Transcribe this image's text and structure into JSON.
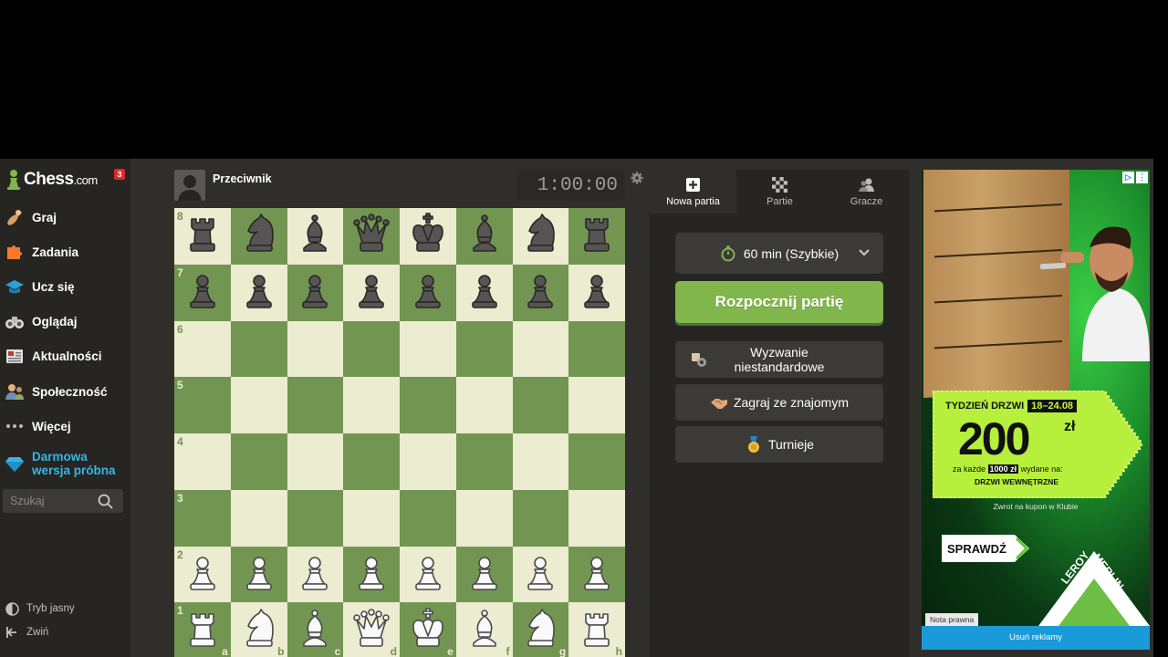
{
  "sidebar": {
    "logo": "Chess",
    "logo_suffix": ".com",
    "notification_count": "3",
    "nav": [
      {
        "label": "Graj",
        "icon": "pawn-hand-icon"
      },
      {
        "label": "Zadania",
        "icon": "puzzle-icon"
      },
      {
        "label": "Ucz się",
        "icon": "graduation-cap-icon"
      },
      {
        "label": "Oglądaj",
        "icon": "binoculars-icon"
      },
      {
        "label": "Aktualności",
        "icon": "newspaper-icon"
      },
      {
        "label": "Społeczność",
        "icon": "community-icon"
      },
      {
        "label": "Więcej",
        "icon": "more-dots-icon"
      }
    ],
    "trial_line1": "Darmowa",
    "trial_line2": "wersja próbna",
    "search_placeholder": "Szukaj",
    "bottom": [
      {
        "label": "Tryb jasny",
        "icon": "contrast-icon"
      },
      {
        "label": "Zwiń",
        "icon": "collapse-icon"
      }
    ]
  },
  "game": {
    "opponent": "Przeciwnik",
    "clock": "1:00:00",
    "files": [
      "a",
      "b",
      "c",
      "d",
      "e",
      "f",
      "g",
      "h"
    ],
    "ranks": [
      "8",
      "7",
      "6",
      "5",
      "4",
      "3",
      "2",
      "1"
    ],
    "position": [
      [
        "bR",
        "bN",
        "bB",
        "bQ",
        "bK",
        "bB",
        "bN",
        "bR"
      ],
      [
        "bP",
        "bP",
        "bP",
        "bP",
        "bP",
        "bP",
        "bP",
        "bP"
      ],
      [
        "",
        "",
        "",
        "",
        "",
        "",
        "",
        ""
      ],
      [
        "",
        "",
        "",
        "",
        "",
        "",
        "",
        ""
      ],
      [
        "",
        "",
        "",
        "",
        "",
        "",
        "",
        ""
      ],
      [
        "",
        "",
        "",
        "",
        "",
        "",
        "",
        ""
      ],
      [
        "wP",
        "wP",
        "wP",
        "wP",
        "wP",
        "wP",
        "wP",
        "wP"
      ],
      [
        "wR",
        "wN",
        "wB",
        "wQ",
        "wK",
        "wB",
        "wN",
        "wR"
      ]
    ]
  },
  "panel": {
    "tabs": [
      {
        "label": "Nowa partia",
        "icon": "plus-square-icon",
        "active": true
      },
      {
        "label": "Partie",
        "icon": "chessboard-icon",
        "active": false
      },
      {
        "label": "Gracze",
        "icon": "players-icon",
        "active": false
      }
    ],
    "time_control": "60 min (Szybkie)",
    "start_label": "Rozpocznij partię",
    "custom_line1": "Wyzwanie",
    "custom_line2": "niestandardowe",
    "friend_label": "Zagraj ze znajomym",
    "tournaments_label": "Turnieje"
  },
  "ad": {
    "week_label": "TYDZIEŃ DRZWI",
    "dates": "18–24.08",
    "amount": "200",
    "currency": "zł",
    "line_prefix": "za każde",
    "line_highlight": "1000 zł",
    "line_suffix": "wydane na:",
    "line2": "DRZWI WEWNĘTRZNE",
    "cashback_note": "Zwrot na kupon w Klubie",
    "cta": "SPRAWDŹ",
    "brand_line1": "LEROY",
    "brand_line2": "MERLIN",
    "legal": "Nota prawna",
    "remove_ads": "Usuń reklamy"
  },
  "colors": {
    "board_light": "#ebecd0",
    "board_dark": "#739552",
    "accent_green": "#81b64c",
    "trial_blue": "#38b5e6"
  }
}
